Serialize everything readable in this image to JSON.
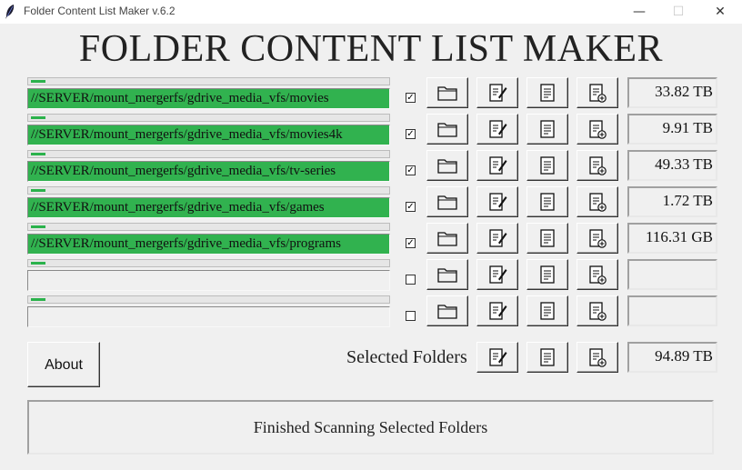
{
  "window": {
    "title": "Folder Content List Maker v.6.2",
    "controls": {
      "minimize": "—",
      "maximize": "☐",
      "close": "✕"
    }
  },
  "header": {
    "title": "FOLDER CONTENT LIST MAKER"
  },
  "colors": {
    "progress_green": "#2bb24c",
    "path_green": "#31b24f",
    "background": "#f0f0f0"
  },
  "rows": [
    {
      "path": "//SERVER/mount_mergerfs/gdrive_media_vfs/movies",
      "checked": true,
      "check_mark": "✓",
      "size": "33.82 TB",
      "progress": 0.04
    },
    {
      "path": "//SERVER/mount_mergerfs/gdrive_media_vfs/movies4k",
      "checked": true,
      "check_mark": "✓",
      "size": "9.91 TB",
      "progress": 0.04
    },
    {
      "path": "//SERVER/mount_mergerfs/gdrive_media_vfs/tv-series",
      "checked": true,
      "check_mark": "✓",
      "size": "49.33 TB",
      "progress": 0.04
    },
    {
      "path": "//SERVER/mount_mergerfs/gdrive_media_vfs/games",
      "checked": true,
      "check_mark": "✓",
      "size": "1.72 TB",
      "progress": 0.04
    },
    {
      "path": "//SERVER/mount_mergerfs/gdrive_media_vfs/programs",
      "checked": true,
      "check_mark": "✓",
      "size": "116.31 GB",
      "progress": 0.04
    },
    {
      "path": "",
      "checked": false,
      "check_mark": "",
      "size": "",
      "progress": 0.04
    },
    {
      "path": "",
      "checked": false,
      "check_mark": "",
      "size": "",
      "progress": 0.04
    }
  ],
  "row_icons": [
    "folder-icon",
    "edit-list-icon",
    "list-document-icon",
    "add-list-icon"
  ],
  "about_button": {
    "label": "About"
  },
  "selected": {
    "label": "Selected Folders",
    "total_size": "94.89 TB"
  },
  "status": {
    "text": "Finished Scanning Selected Folders"
  }
}
